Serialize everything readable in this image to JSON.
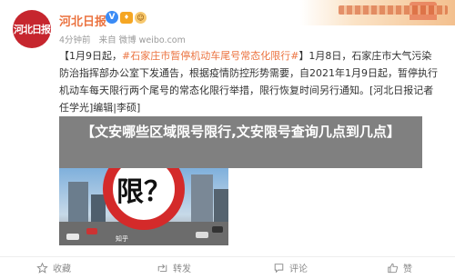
{
  "account": {
    "name": "河北日报",
    "avatar_text": "河北日报",
    "badges": [
      "verified-icon",
      "vip-icon",
      "emoji-icon"
    ]
  },
  "meta": {
    "time": "4分钟前",
    "source": "来自 微博 weibo.com"
  },
  "post": {
    "date_prefix": "【1月9日起，",
    "hashtag": "#石家庄市暂停机动车尾号常态化限行#",
    "body": "】1月8日，石家庄市大气污染防治指挥部办公室下发通告，根据疫情防控形势需要，自2021年1月9日起，暂停执行机动车每天限行两个尾号的常态化限行举措，限行恢复时间另行通知。[河北日报记者任学光]编辑|李硕]"
  },
  "overlay": {
    "headline": "【文安哪些区域限号限行,文安限号查询几点到几点】"
  },
  "image": {
    "sign_text": "限？",
    "watermark": "知乎"
  },
  "actions": {
    "favorite": "收藏",
    "share": "转发",
    "comment": "评论",
    "like": "赞"
  },
  "colors": {
    "brand_orange": "#eb7340",
    "verified_blue": "#3a8bf5",
    "sign_red": "#d42a2a",
    "avatar_red": "#c6262e"
  }
}
